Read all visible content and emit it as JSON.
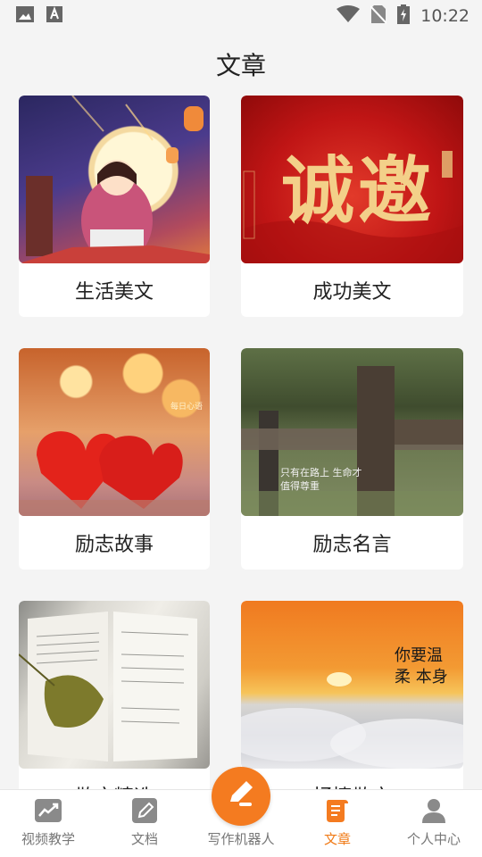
{
  "status_bar": {
    "time": "10:22"
  },
  "page": {
    "title": "文章"
  },
  "cards": [
    {
      "label": "生活美文",
      "image": "night-lantern-girl-illustration"
    },
    {
      "label": "成功美文",
      "image": "red-calligraphy-banner",
      "image_text": "诚邀"
    },
    {
      "label": "励志故事",
      "image": "red-hearts-bokeh",
      "image_text": "每日心语"
    },
    {
      "label": "励志名言",
      "image": "wooden-fence-post",
      "image_text": "只有在路上 生命才值得尊重"
    },
    {
      "label": "散文精选",
      "image": "open-book-with-leaf"
    },
    {
      "label": "抒情散文",
      "image": "sunset-above-clouds",
      "image_text": "你要温柔 本身"
    }
  ],
  "bottom_nav": {
    "items": [
      {
        "label": "视频教学",
        "icon": "video-teach-icon",
        "active": false
      },
      {
        "label": "文档",
        "icon": "document-edit-icon",
        "active": false
      },
      {
        "label": "写作机器人",
        "icon": "pen-write-icon",
        "active": false
      },
      {
        "label": "文章",
        "icon": "article-scroll-icon",
        "active": true
      },
      {
        "label": "个人中心",
        "icon": "person-icon",
        "active": false
      }
    ]
  },
  "colors": {
    "accent": "#f47b20",
    "active_text": "#f07a16",
    "inactive_text": "#777777",
    "background": "#f4f4f4"
  }
}
